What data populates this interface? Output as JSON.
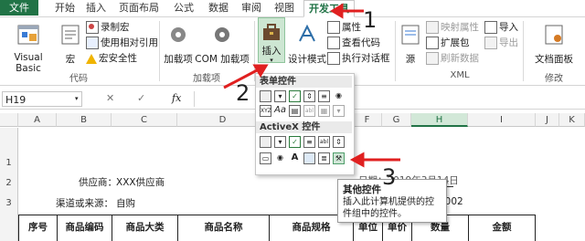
{
  "tabs": [
    "文件",
    "开始",
    "插入",
    "页面布局",
    "公式",
    "数据",
    "审阅",
    "视图",
    "开发工具"
  ],
  "ribbon": {
    "code": {
      "vb": "Visual Basic",
      "macro": "宏",
      "record": "录制宏",
      "relative": "使用相对引用",
      "security": "宏安全性",
      "label": "代码"
    },
    "addins": {
      "addins": "加载项",
      "com": "COM 加载项",
      "label": "加载项"
    },
    "controls": {
      "insert": "插入",
      "design": "设计模式",
      "properties": "属性",
      "view_code": "查看代码",
      "run_dialog": "执行对话框"
    },
    "xml": {
      "source": "源",
      "map_props": "映射属性",
      "expansion": "扩展包",
      "refresh": "刷新数据",
      "import": "导入",
      "export": "导出",
      "label": "XML"
    },
    "modify": {
      "doc_panel": "文档面板",
      "label": "修改"
    }
  },
  "formula_bar": {
    "name_box": "H19",
    "fx": "fx"
  },
  "columns": [
    "A",
    "B",
    "C",
    "D",
    "E",
    "F",
    "G",
    "H",
    "I",
    "J",
    "K"
  ],
  "rows": [
    "1",
    "2",
    "3"
  ],
  "sheet": {
    "supplier_label": "供应商：",
    "supplier_value": "XXX供应商",
    "channel_label": "渠道或来源：",
    "channel_value": "自购",
    "date_partial": "日期：2019年3月14日",
    "order_partial": "1002",
    "headers": [
      "序号",
      "商品编码",
      "商品大类",
      "商品名称",
      "商品规格",
      "单位",
      "单价",
      "数量",
      "金额"
    ]
  },
  "dropdown": {
    "form_controls": "表单控件",
    "activex_controls": "ActiveX 控件"
  },
  "tooltip": {
    "title": "其他控件",
    "desc": "插入此计算机提供的控件组中的控件。"
  },
  "annotations": [
    "1",
    "2",
    "3"
  ],
  "colors": {
    "excel_green": "#217346",
    "arrow_red": "#e02020"
  }
}
